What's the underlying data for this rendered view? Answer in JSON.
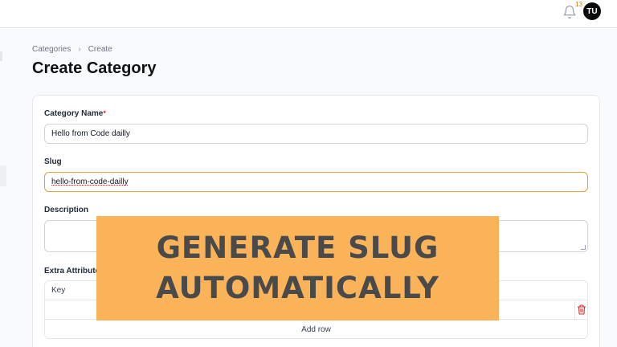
{
  "topbar": {
    "notification_count": "13",
    "avatar_initials": "TU"
  },
  "breadcrumb": {
    "items": [
      "Categories",
      "Create"
    ]
  },
  "page": {
    "title": "Create Category"
  },
  "form": {
    "name": {
      "label": "Category Name",
      "required_mark": "*",
      "value": "Hello from Code dailly"
    },
    "slug": {
      "label": "Slug",
      "value": "hello-from-code-dailly"
    },
    "description": {
      "label": "Description",
      "value": ""
    },
    "extra_attributes": {
      "label": "Extra Attributes",
      "key_header": "Key",
      "add_row_label": "Add row"
    }
  },
  "banner": {
    "line1": "GENERATE SLUG",
    "line2": "AUTOMATICALLY"
  },
  "colors": {
    "accent": "#d9a441",
    "banner_bg": "#fbb35a",
    "banner_text": "#4a4a4a",
    "danger": "#dc2626",
    "badge": "#d97706"
  },
  "icons": {
    "bell": "bell-icon",
    "chevron": "chevron-right-icon",
    "trash": "trash-icon"
  }
}
